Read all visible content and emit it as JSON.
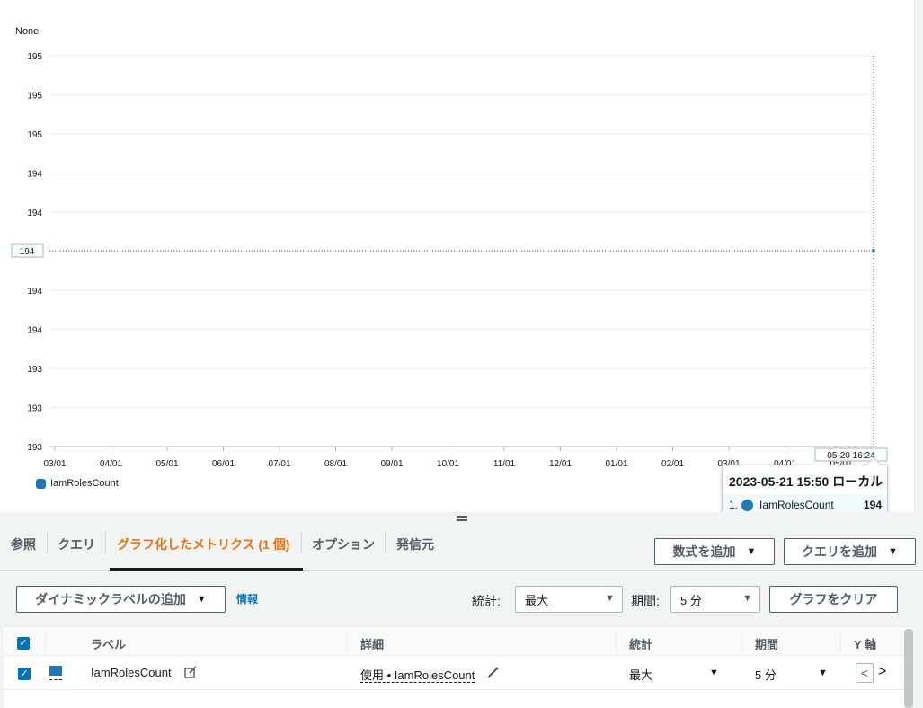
{
  "chart_data": {
    "type": "line",
    "unit_label": "None",
    "y_tick_labels": [
      "195",
      "195",
      "195",
      "194",
      "194",
      "194",
      "194",
      "194",
      "193",
      "193",
      "193"
    ],
    "x_tick_labels": [
      "03/01",
      "04/01",
      "05/01",
      "06/01",
      "07/01",
      "08/01",
      "09/01",
      "10/01",
      "11/01",
      "12/01",
      "01/01",
      "02/01",
      "03/01",
      "04/01",
      "05/01"
    ],
    "crosshair_y_label": "194",
    "crosshair_x_label": "05-20 16:24",
    "series": [
      {
        "name": "IamRolesCount",
        "color": "#1f77b4",
        "points": [
          {
            "x": "05-20 16:24",
            "y": 194
          }
        ]
      }
    ],
    "legend": {
      "position": "bottom-left"
    },
    "grid": true
  },
  "tooltip": {
    "title": "2023-05-21 15:50 ローカル",
    "index": "1.",
    "series_name": "IamRolesCount",
    "value": "194"
  },
  "tabs": [
    {
      "label": "参照",
      "active": false
    },
    {
      "label": "クエリ",
      "active": false
    },
    {
      "label": "グラフ化したメトリクス (1 個)",
      "active": true
    },
    {
      "label": "オプション",
      "active": false
    },
    {
      "label": "発信元",
      "active": false
    }
  ],
  "buttons": {
    "add_math": "数式を追加",
    "add_query": "クエリを追加",
    "add_dynamic_label": "ダイナミックラベルの追加",
    "clear_graph": "グラフをクリア"
  },
  "info_link": "情報",
  "filters": {
    "statistic_label": "統計:",
    "statistic_value": "最大",
    "period_label": "期間:",
    "period_value": "5 分"
  },
  "table": {
    "headers": [
      "ラベル",
      "詳細",
      "統計",
      "期間",
      "Y 軸"
    ],
    "rows": [
      {
        "label": "IamRolesCount",
        "detail": "使用 • IamRolesCount",
        "statistic": "最大",
        "period": "5 分",
        "color": "#1f77b4"
      }
    ]
  },
  "icons": {
    "checkbox": "checkmark",
    "edit": "edit-icon",
    "caret": "caret-down-icon"
  }
}
